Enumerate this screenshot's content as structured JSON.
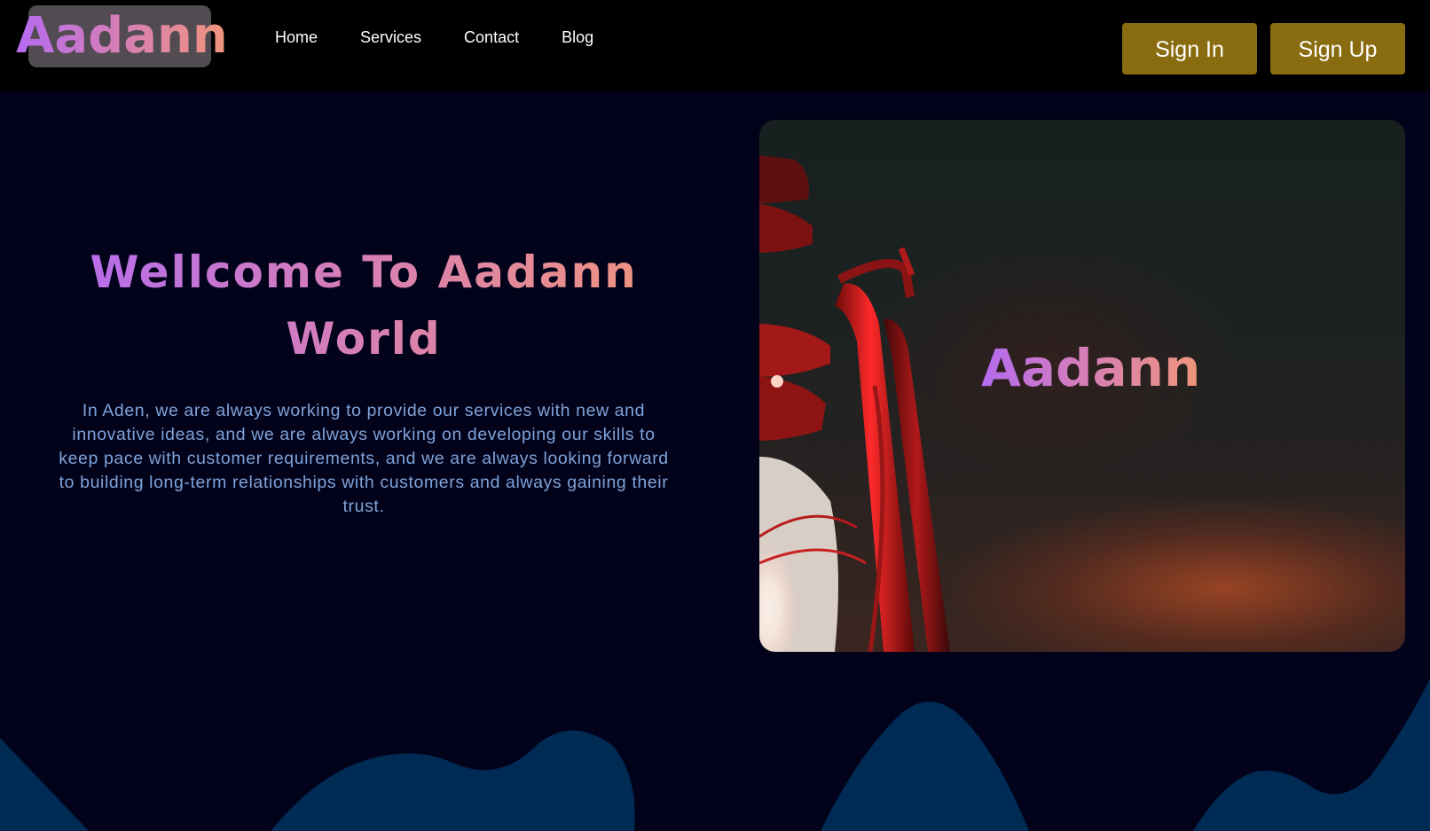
{
  "header": {
    "logo": "Aadann",
    "nav": [
      {
        "label": "Home"
      },
      {
        "label": "Services"
      },
      {
        "label": "Contact"
      },
      {
        "label": "Blog"
      }
    ],
    "sign_in_label": "Sign In",
    "sign_up_label": "Sign Up"
  },
  "hero": {
    "title_line1": "Wellcome To Aadann",
    "title_line2": "World",
    "description": "In Aden, we are always working to provide our services with new and innovative ideas, and we are always working on developing our skills to keep pace with customer requirements, and we are always looking forward to building long-term relationships with customers and always gaining their trust.",
    "card_brand": "Aadann",
    "card_image": "red-lantern-photo"
  },
  "colors": {
    "page_background": "#02021a",
    "navbar_background": "#000000",
    "button_background": "#8a6c10",
    "gradient_start": "#b46bf0",
    "gradient_end": "#f0957a",
    "body_text": "#7fa3d9",
    "wave": "#002b55"
  }
}
